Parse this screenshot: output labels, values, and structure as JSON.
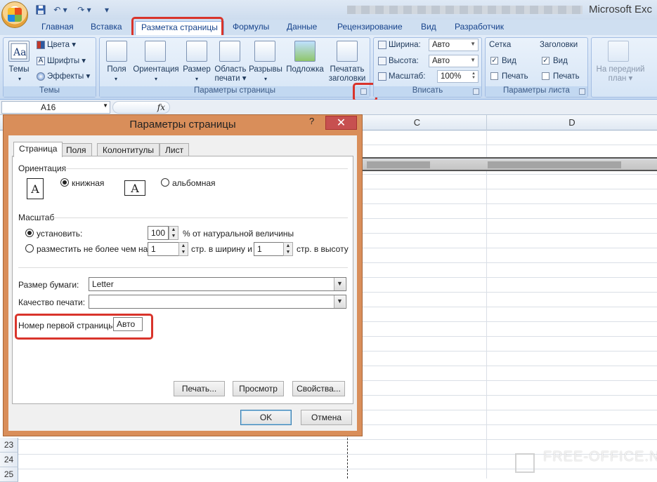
{
  "titlebar": {
    "app_title": "Microsoft Exc",
    "qat_save_icon": "floppy-disk",
    "qat_undo": "↶ ▾",
    "qat_redo": "↷ ▾",
    "qat_customize": "▾"
  },
  "tabs": [
    "Главная",
    "Вставка",
    "Разметка страницы",
    "Формулы",
    "Данные",
    "Рецензирование",
    "Вид",
    "Разработчик"
  ],
  "ribbon": {
    "themes": {
      "big": "Темы",
      "colors": "Цвета",
      "fonts": "Шрифты",
      "effects": "Эффекты",
      "label": "Темы"
    },
    "page_setup": {
      "margins": "Поля",
      "orientation": "Ориентация",
      "size": "Размер",
      "print_area_1": "Область",
      "print_area_2": "печати",
      "breaks": "Разрывы",
      "background": "Подложка",
      "print_titles_1": "Печатать",
      "print_titles_2": "заголовки",
      "label": "Параметры страницы"
    },
    "fit": {
      "width_label": "Ширина:",
      "width_value": "Авто",
      "height_label": "Высота:",
      "height_value": "Авто",
      "scale_label": "Масштаб:",
      "scale_value": "100%",
      "label": "Вписать"
    },
    "sheet_options": {
      "grid": "Сетка",
      "headings": "Заголовки",
      "view1": "Вид",
      "view2": "Вид",
      "print1": "Печать",
      "print2": "Печать",
      "label": "Параметры листа"
    },
    "arrange": {
      "line1": "На передний",
      "line2": "план"
    }
  },
  "formula_bar": {
    "name_box": "A16",
    "fx": "fx"
  },
  "columns": {
    "c": "C",
    "d": "D"
  },
  "rows": [
    "23",
    "24",
    "25"
  ],
  "dialog": {
    "title": "Параметры страницы",
    "help": "?",
    "close": "✕",
    "tabs": [
      "Страница",
      "Поля",
      "Колонтитулы",
      "Лист"
    ],
    "orientation_label": "Ориентация",
    "portrait": "книжная",
    "landscape": "альбомная",
    "glyph": "A",
    "scale_label": "Масштаб",
    "scale_set": "установить:",
    "scale_value": "100",
    "scale_suffix": "% от натуральной величины",
    "fit_to": "разместить не более чем на:",
    "fit_wide_value": "1",
    "fit_wide_suffix": "стр. в ширину и",
    "fit_tall_value": "1",
    "fit_tall_suffix": "стр. в высоту",
    "paper_size_label": "Размер бумаги:",
    "paper_size_value": "Letter",
    "print_quality_label": "Качество печати:",
    "print_quality_value": "",
    "first_page_label": "Номер первой страницы:",
    "first_page_value": "Авто",
    "print_btn": "Печать...",
    "preview_btn": "Просмотр",
    "properties_btn": "Свойства...",
    "ok_btn": "OK",
    "cancel_btn": "Отмена"
  },
  "watermark": "FREE-OFFICE.NET",
  "colors": {
    "highlight": "#d9342b",
    "dialog_frame": "#d98e5a",
    "ribbon_text": "#15428b"
  }
}
